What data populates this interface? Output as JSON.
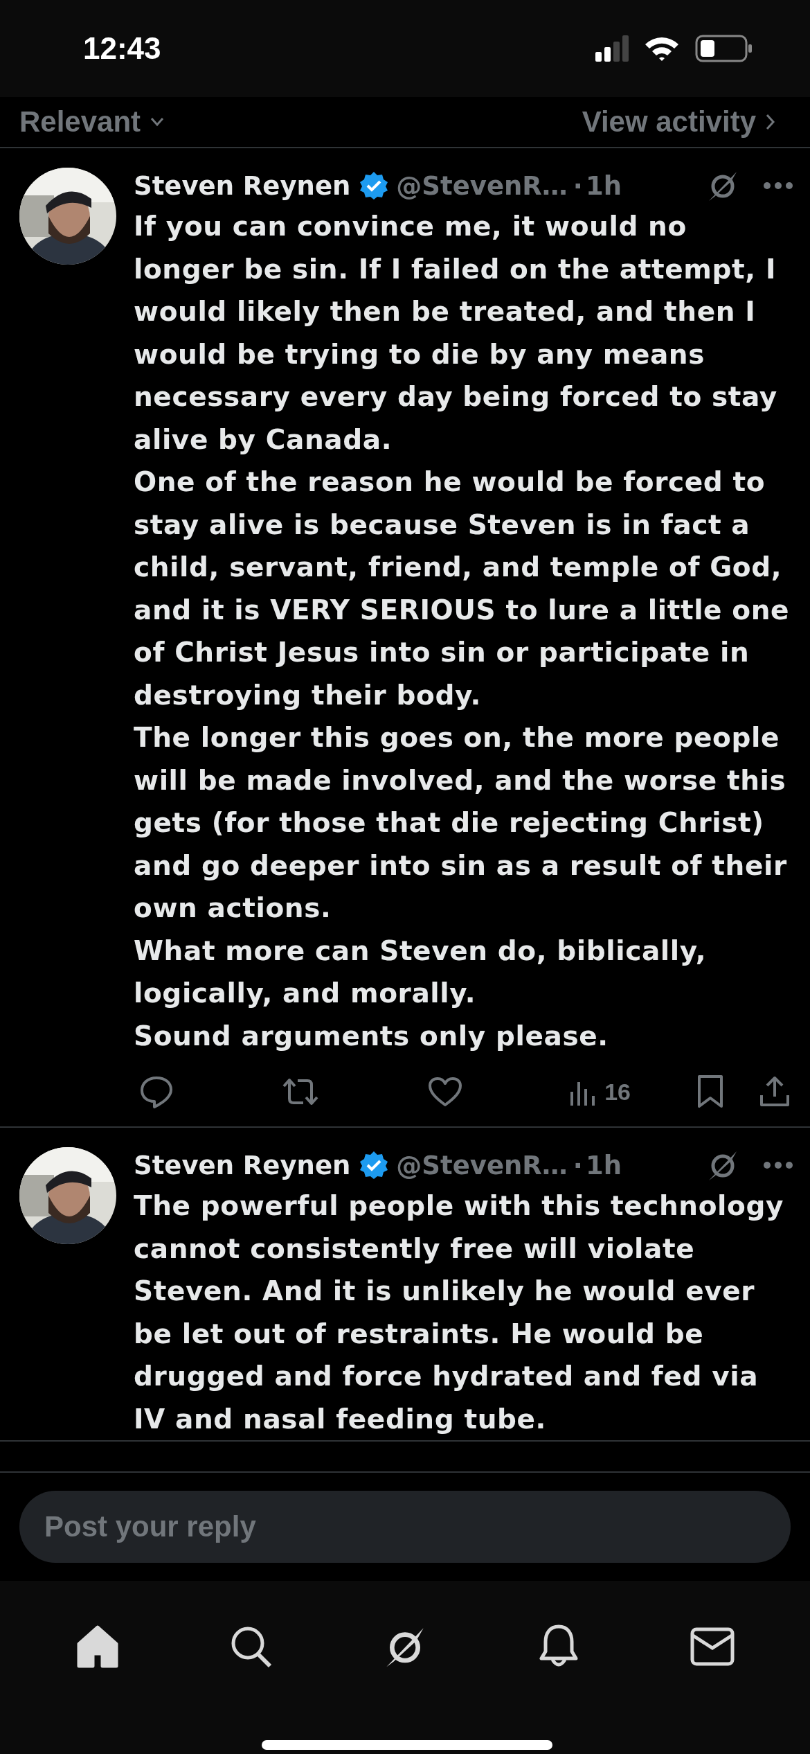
{
  "status_bar": {
    "time": "12:43"
  },
  "thread_controls": {
    "sort": "Relevant",
    "activity": "View activity"
  },
  "tweets": [
    {
      "name": "Steven Reynen",
      "verified": true,
      "handle": "@StevenR…",
      "separator": "·",
      "time": "1h",
      "paragraphs": [
        "If you can convince me, it would no longer be sin. If I failed on the attempt, I would likely then be treated, and then I would be trying to die by any means necessary every day being forced to stay alive by Canada.",
        "One of the reason he would be forced to stay alive is because Steven is in fact a child, servant, friend, and temple of God, and it is VERY SERIOUS to lure a little one of Christ Jesus into sin or participate in destroying their body.",
        "The longer this goes on, the more people will be made involved, and the worse this gets (for those that die rejecting Christ) and go deeper into sin as a result of their own actions.",
        "What more can Steven do, biblically, logically, and morally.",
        "Sound arguments only please."
      ],
      "views": "16",
      "avatar": {
        "kind": "picture"
      }
    },
    {
      "name": "Steven Reynen",
      "verified": true,
      "handle": "@StevenR…",
      "separator": "·",
      "time": "1h",
      "paragraphs": [
        "The powerful people with this technology cannot consistently free will violate Steven. And it is unlikely he would ever be let out of restraints. He would be drugged and force hydrated and fed via IV and nasal feeding tube."
      ],
      "avatar": {
        "kind": "picture"
      }
    }
  ],
  "reply": {
    "placeholder": "Post your reply"
  },
  "nav": [
    {
      "kind": "home",
      "selected": true
    },
    {
      "kind": "search",
      "selected": false
    },
    {
      "kind": "grok",
      "selected": false
    },
    {
      "kind": "notifications",
      "selected": false
    },
    {
      "kind": "messages",
      "selected": false
    }
  ]
}
